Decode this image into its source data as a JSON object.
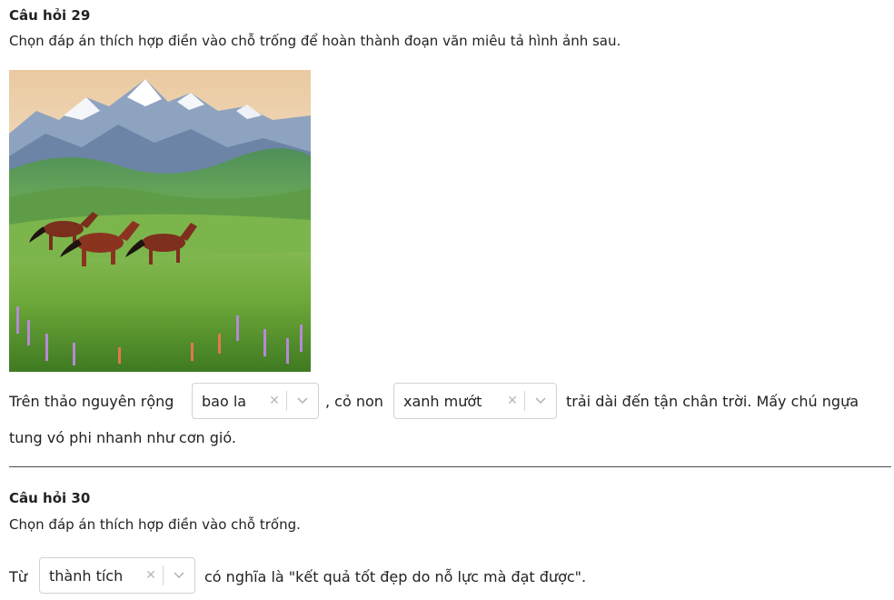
{
  "q29": {
    "title": "Câu hỏi 29",
    "prompt": "Chọn đáp án thích hợp điền vào chỗ trống để hoàn thành đoạn văn miêu tả hình ảnh sau.",
    "image_icon": "landscape-horses-image",
    "text_before_1": "Trên thảo nguyên rộng",
    "select1_value": "bao la",
    "text_between": ", cỏ non",
    "select2_value": "xanh mướt",
    "text_after_2": "trải dài đến tận chân trời. Mấy chú ngựa",
    "text_line2": "tung vó phi nhanh như cơn gió."
  },
  "q30": {
    "title": "Câu hỏi 30",
    "prompt": "Chọn đáp án thích hợp điền vào chỗ trống.",
    "text_before": "Từ",
    "select_value": "thành tích",
    "text_after": "có nghĩa là \"kết quả tốt đẹp do nỗ lực mà đạt được\"."
  },
  "icons": {
    "clear": "close-icon",
    "dropdown": "chevron-down-icon"
  },
  "colors": {
    "border": "#d2d2d2",
    "divider": "#4a4a4a",
    "text": "#222222"
  }
}
